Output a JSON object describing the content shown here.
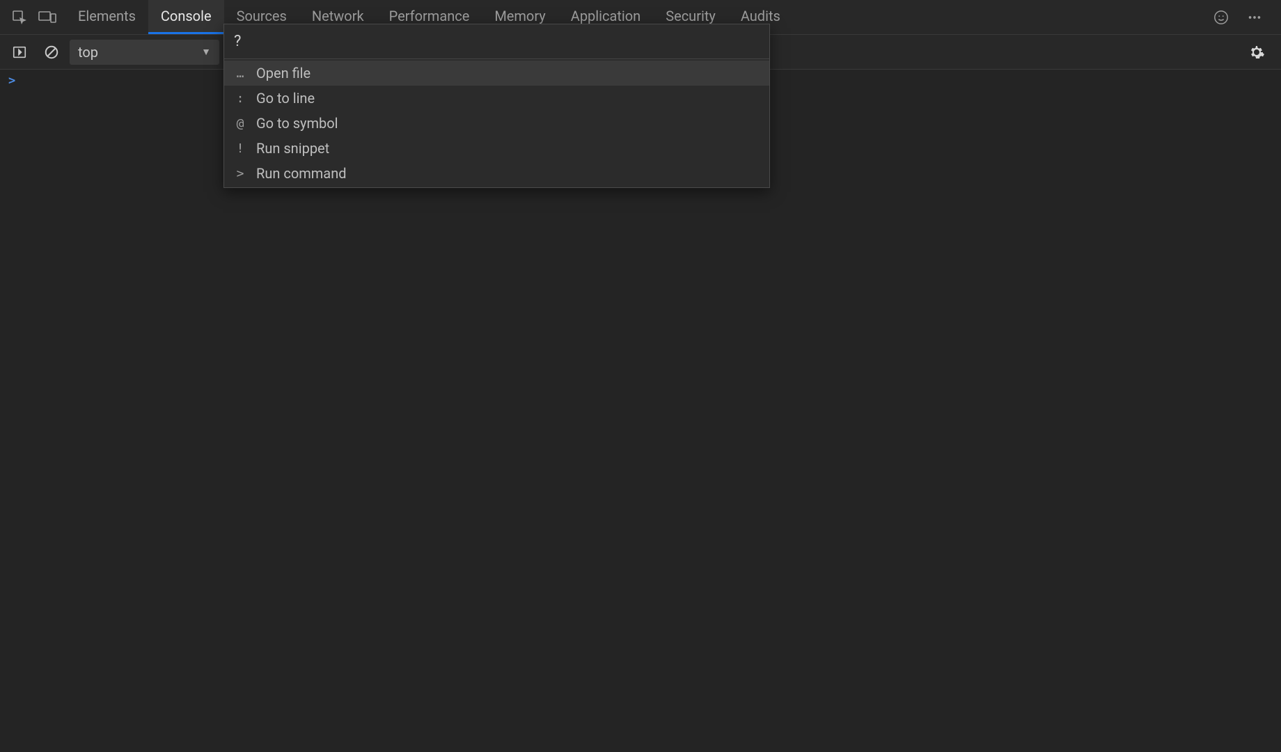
{
  "tabs": [
    {
      "label": "Elements",
      "active": false
    },
    {
      "label": "Console",
      "active": true
    },
    {
      "label": "Sources",
      "active": false
    },
    {
      "label": "Network",
      "active": false
    },
    {
      "label": "Performance",
      "active": false
    },
    {
      "label": "Memory",
      "active": false
    },
    {
      "label": "Application",
      "active": false
    },
    {
      "label": "Security",
      "active": false
    },
    {
      "label": "Audits",
      "active": false
    }
  ],
  "toolbar": {
    "context_selected": "top"
  },
  "command_menu": {
    "input_value": "?",
    "items": [
      {
        "prefix": "…",
        "label": "Open file",
        "highlight": true
      },
      {
        "prefix": ":",
        "label": "Go to line",
        "highlight": false
      },
      {
        "prefix": "@",
        "label": "Go to symbol",
        "highlight": false
      },
      {
        "prefix": "!",
        "label": "Run snippet",
        "highlight": false
      },
      {
        "prefix": ">",
        "label": "Run command",
        "highlight": false
      }
    ]
  },
  "console": {
    "prompt": ">"
  }
}
